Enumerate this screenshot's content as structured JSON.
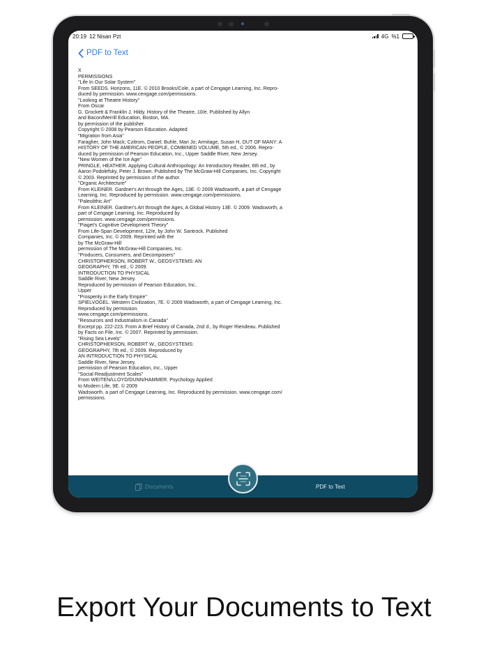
{
  "status_bar": {
    "time": "20:19",
    "date": "12 Nisan Pzt",
    "network": "4G",
    "battery": "%1"
  },
  "nav": {
    "back_label": "PDF to Text"
  },
  "document": {
    "lines": [
      "X",
      "PERMISSIONS",
      "\"Life In Our Solar System\"",
      "From SEEDS. Horizons, 11E. © 2010 Brooks/Cole, a part of Cengage Learning, Inc. Repro-",
      "duced by permission. www.cengage.com/permissions.",
      "\"Looking at Theatre History\"",
      "From Oscar",
      "G. Grockett & Franklin J. Hildy. History of the Theatre, 10/e. Published by Allyn",
      "and Bacon/Merrill Education, Boston, MA.",
      "by permission of the publisher.",
      "Copyright © 2008 by Pearson Education. Adapted",
      "\"Migration from Asia\"",
      "Faragher, John Mack; Czitrom, Daniel; Buhle, Mari Jo; Armitage, Susan H, OUT OF MANY: A",
      "HISTORY OF THE AMERICAN PEOPLE, COMBINED VOLUME, 5th ed., © 2006. Repro-",
      "duced by permission of Pearson Education, Inc., Upper Saddle River, New Jersey.",
      "\"New Women of the Ice Age\"",
      "PRINGLE, HEATHER. Applying Cultural Anthropology: An Introductory Reader, 6th ed., by",
      "Aaron Podolefsky, Peter J. Brown. Published by The McGraw-Hill Companies, Inc. Copyright",
      "© 2003. Reprinted by permission of the author.",
      "\"Organic Architecture\"",
      "From KLEINER. Gardner's Art through the Ages, 13E. © 2009 Wadsworth, a part of Cengage",
      "Learning, Inc. Reproduced by permission. www.cengage.com/permissions.",
      "\"Paleolithic Art\"",
      "From KLEINER. Gardner's Art through the Ages, A Global History 13E. © 2009. Wadsworth, a",
      "part of Cengage Learning, Inc. Reproduced by",
      "permission. www.cengage.com/permissions.",
      "\"Piaget's Cognitive Development Theory\"",
      "From Life-Span Development, 12/e, by John W. Santrock. Published",
      "Companies, Inc. © 2009. Reprinted with the",
      "by The McGraw-Hill",
      "permission of The McGraw-Hill Companies, Inc.",
      "\"Producers, Consumers, and Decomposers\"",
      "CHRISTOPHERSON, ROBERT W., GEOSYSTEMS: AN",
      "GEOGRAPHY, 7th ed., © 2009.",
      "INTRODUCTION TO PHYSICAL",
      "Saddle River, New Jersey.",
      "Reproduced by permission of Pearson Education, Inc..",
      "Upper",
      "\"Prosperity in the Early Empire\"",
      "SPIELVOGEL. Western Civilization, 7E. © 2009 Wadsworth, a part of Cengage Learning, Inc.",
      "Reproduced by permission.",
      "www.cengage.com/permissions.",
      "\"Resources and Industrialism in Canada\"",
      "Excerpt pp. 222-223. From A Brief History of Canada, 2nd d., by Roger Riendeau. Published",
      "by Facts on File, Inc. © 2007. Reprinted by permission.",
      "\"Rising Sea Levels\"",
      "CHRISTOPHERSON, ROBERT W., GEOSYSTEMS:",
      "GEOGRAPHY, 7th ed., © 2009. Reproduced by",
      "AN INTRODUCTION TO PHYSICAL",
      "Saddle River, New Jersey.",
      "permission of Pearson Education, Inc., Upper",
      "\"Social Readjustment Scales\"",
      "From WEITEN/LLOYD/DUNN/HAMMER. Psychology Applied",
      "to Modern Life, 9E. © 2009",
      "Wadsworth. a part of Cengage Learning, Inc. Reproduced by permission. www.cengage.com/",
      "permissions."
    ]
  },
  "tab_bar": {
    "documents_label": "Documents",
    "pdf_to_text_label": "PDF to Text",
    "scan_icon": "scan-icon",
    "background_color": "#0f4c63"
  },
  "colors": {
    "accent": "#2f7bf5",
    "device_frame": "#1c1c1e"
  },
  "caption": "Export Your Documents to Text"
}
